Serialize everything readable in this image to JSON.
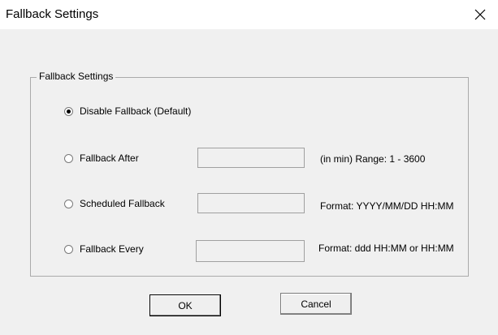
{
  "window": {
    "title": "Fallback Settings",
    "close_icon": "close-icon"
  },
  "group": {
    "legend": "Fallback Settings"
  },
  "options": [
    {
      "label": "Disable Fallback (Default)",
      "selected": true
    },
    {
      "label": "Fallback After",
      "selected": false,
      "value": "",
      "hint": "(in min) Range: 1 - 3600"
    },
    {
      "label": "Scheduled Fallback",
      "selected": false,
      "value": "",
      "hint": "Format: YYYY/MM/DD HH:MM"
    },
    {
      "label": "Fallback Every",
      "selected": false,
      "value": "",
      "hint": "Format: ddd HH:MM or HH:MM"
    }
  ],
  "buttons": {
    "ok": "OK",
    "cancel": "Cancel"
  }
}
